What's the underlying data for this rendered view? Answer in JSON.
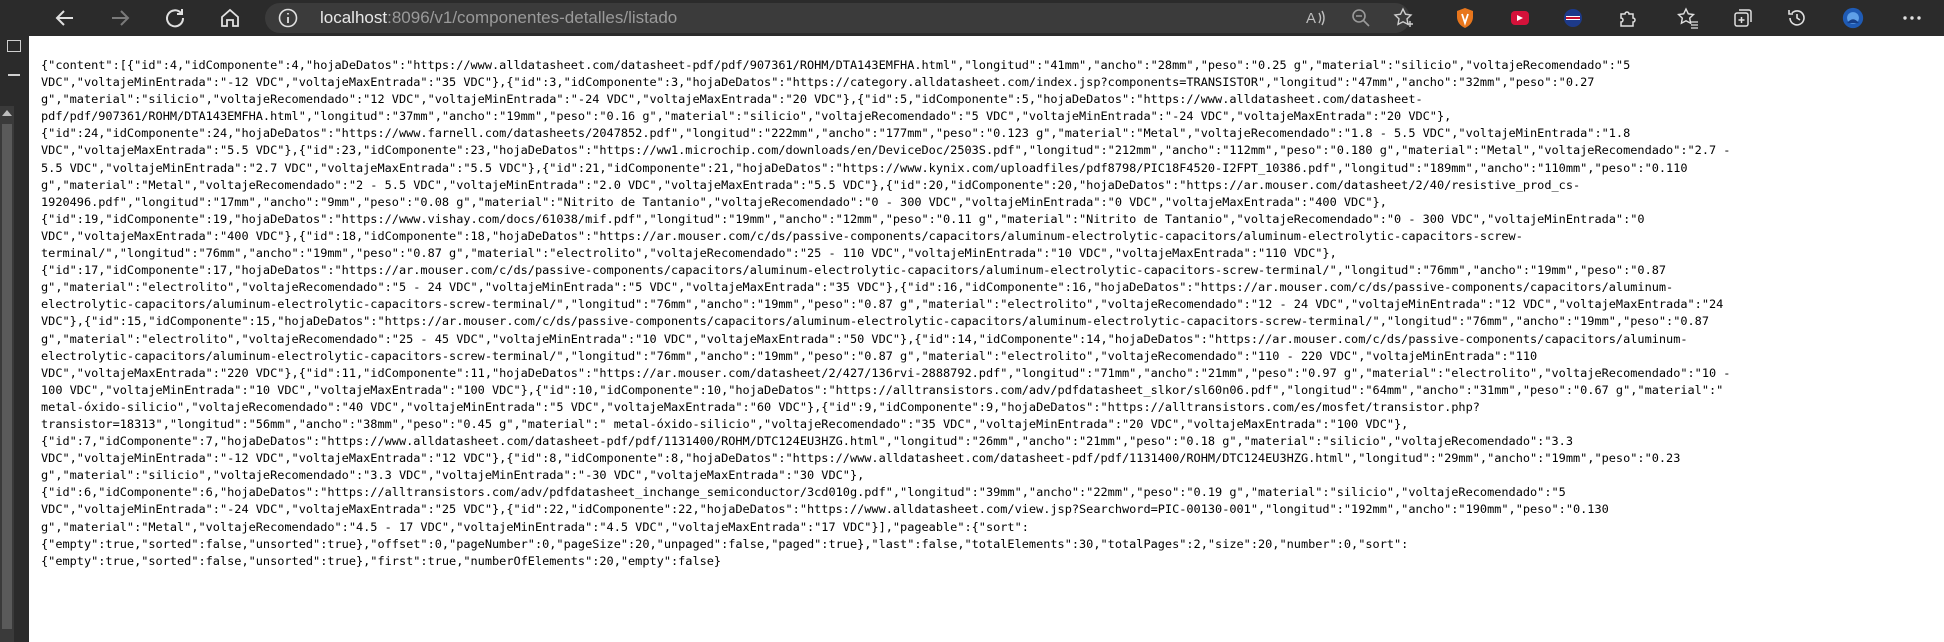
{
  "browser": {
    "url_host": "localhost",
    "url_rest": ":8096/v1/componentes-detalles/listado"
  },
  "json_lines": [
    "{\"content\":[{\"id\":4,\"idComponente\":4,\"hojaDeDatos\":\"https://www.alldatasheet.com/datasheet-pdf/pdf/907361/ROHM/DTA143EMFHA.html\",\"longitud\":\"41mm\",\"ancho\":\"28mm\",\"peso\":\"0.25 g\",\"material\":\"silicio\",\"voltajeRecomendado\":\"5",
    "VDC\",\"voltajeMinEntrada\":\"-12 VDC\",\"voltajeMaxEntrada\":\"35 VDC\"},{\"id\":3,\"idComponente\":3,\"hojaDeDatos\":\"https://category.alldatasheet.com/index.jsp?components=TRANSISTOR\",\"longitud\":\"47mm\",\"ancho\":\"32mm\",\"peso\":\"0.27",
    "g\",\"material\":\"silicio\",\"voltajeRecomendado\":\"12 VDC\",\"voltajeMinEntrada\":\"-24 VDC\",\"voltajeMaxEntrada\":\"20 VDC\"},{\"id\":5,\"idComponente\":5,\"hojaDeDatos\":\"https://www.alldatasheet.com/datasheet-",
    "pdf/pdf/907361/ROHM/DTA143EMFHA.html\",\"longitud\":\"37mm\",\"ancho\":\"19mm\",\"peso\":\"0.16 g\",\"material\":\"silicio\",\"voltajeRecomendado\":\"5 VDC\",\"voltajeMinEntrada\":\"-24 VDC\",\"voltajeMaxEntrada\":\"20 VDC\"},",
    "{\"id\":24,\"idComponente\":24,\"hojaDeDatos\":\"https://www.farnell.com/datasheets/2047852.pdf\",\"longitud\":\"222mm\",\"ancho\":\"177mm\",\"peso\":\"0.123 g\",\"material\":\"Metal\",\"voltajeRecomendado\":\"1.8 - 5.5 VDC\",\"voltajeMinEntrada\":\"1.8",
    "VDC\",\"voltajeMaxEntrada\":\"5.5 VDC\"},{\"id\":23,\"idComponente\":23,\"hojaDeDatos\":\"https://ww1.microchip.com/downloads/en/DeviceDoc/2503S.pdf\",\"longitud\":\"212mm\",\"ancho\":\"112mm\",\"peso\":\"0.180 g\",\"material\":\"Metal\",\"voltajeRecomendado\":\"2.7 -",
    "5.5 VDC\",\"voltajeMinEntrada\":\"2.7 VDC\",\"voltajeMaxEntrada\":\"5.5 VDC\"},{\"id\":21,\"idComponente\":21,\"hojaDeDatos\":\"https://www.kynix.com/uploadfiles/pdf8798/PIC18F4520-I2FPT_10386.pdf\",\"longitud\":\"189mm\",\"ancho\":\"110mm\",\"peso\":\"0.110",
    "g\",\"material\":\"Metal\",\"voltajeRecomendado\":\"2 - 5.5 VDC\",\"voltajeMinEntrada\":\"2.0 VDC\",\"voltajeMaxEntrada\":\"5.5 VDC\"},{\"id\":20,\"idComponente\":20,\"hojaDeDatos\":\"https://ar.mouser.com/datasheet/2/40/resistive_prod_cs-",
    "1920496.pdf\",\"longitud\":\"17mm\",\"ancho\":\"9mm\",\"peso\":\"0.08 g\",\"material\":\"Nitrito de Tantanio\",\"voltajeRecomendado\":\"0 - 300 VDC\",\"voltajeMinEntrada\":\"0 VDC\",\"voltajeMaxEntrada\":\"400 VDC\"},",
    "{\"id\":19,\"idComponente\":19,\"hojaDeDatos\":\"https://www.vishay.com/docs/61038/mif.pdf\",\"longitud\":\"19mm\",\"ancho\":\"12mm\",\"peso\":\"0.11 g\",\"material\":\"Nitrito de Tantanio\",\"voltajeRecomendado\":\"0 - 300 VDC\",\"voltajeMinEntrada\":\"0",
    "VDC\",\"voltajeMaxEntrada\":\"400 VDC\"},{\"id\":18,\"idComponente\":18,\"hojaDeDatos\":\"https://ar.mouser.com/c/ds/passive-components/capacitors/aluminum-electrolytic-capacitors/aluminum-electrolytic-capacitors-screw-",
    "terminal/\",\"longitud\":\"76mm\",\"ancho\":\"19mm\",\"peso\":\"0.87 g\",\"material\":\"electrolito\",\"voltajeRecomendado\":\"25 - 110 VDC\",\"voltajeMinEntrada\":\"10 VDC\",\"voltajeMaxEntrada\":\"110 VDC\"},",
    "{\"id\":17,\"idComponente\":17,\"hojaDeDatos\":\"https://ar.mouser.com/c/ds/passive-components/capacitors/aluminum-electrolytic-capacitors/aluminum-electrolytic-capacitors-screw-terminal/\",\"longitud\":\"76mm\",\"ancho\":\"19mm\",\"peso\":\"0.87",
    "g\",\"material\":\"electrolito\",\"voltajeRecomendado\":\"5 - 24 VDC\",\"voltajeMinEntrada\":\"5 VDC\",\"voltajeMaxEntrada\":\"35 VDC\"},{\"id\":16,\"idComponente\":16,\"hojaDeDatos\":\"https://ar.mouser.com/c/ds/passive-components/capacitors/aluminum-",
    "electrolytic-capacitors/aluminum-electrolytic-capacitors-screw-terminal/\",\"longitud\":\"76mm\",\"ancho\":\"19mm\",\"peso\":\"0.87 g\",\"material\":\"electrolito\",\"voltajeRecomendado\":\"12 - 24 VDC\",\"voltajeMinEntrada\":\"12 VDC\",\"voltajeMaxEntrada\":\"24",
    "VDC\"},{\"id\":15,\"idComponente\":15,\"hojaDeDatos\":\"https://ar.mouser.com/c/ds/passive-components/capacitors/aluminum-electrolytic-capacitors/aluminum-electrolytic-capacitors-screw-terminal/\",\"longitud\":\"76mm\",\"ancho\":\"19mm\",\"peso\":\"0.87",
    "g\",\"material\":\"electrolito\",\"voltajeRecomendado\":\"25 - 45 VDC\",\"voltajeMinEntrada\":\"10 VDC\",\"voltajeMaxEntrada\":\"50 VDC\"},{\"id\":14,\"idComponente\":14,\"hojaDeDatos\":\"https://ar.mouser.com/c/ds/passive-components/capacitors/aluminum-",
    "electrolytic-capacitors/aluminum-electrolytic-capacitors-screw-terminal/\",\"longitud\":\"76mm\",\"ancho\":\"19mm\",\"peso\":\"0.87 g\",\"material\":\"electrolito\",\"voltajeRecomendado\":\"110 - 220 VDC\",\"voltajeMinEntrada\":\"110",
    "VDC\",\"voltajeMaxEntrada\":\"220 VDC\"},{\"id\":11,\"idComponente\":11,\"hojaDeDatos\":\"https://ar.mouser.com/datasheet/2/427/136rvi-2888792.pdf\",\"longitud\":\"71mm\",\"ancho\":\"21mm\",\"peso\":\"0.97 g\",\"material\":\"electrolito\",\"voltajeRecomendado\":\"10 -",
    "100 VDC\",\"voltajeMinEntrada\":\"10 VDC\",\"voltajeMaxEntrada\":\"100 VDC\"},{\"id\":10,\"idComponente\":10,\"hojaDeDatos\":\"https://alltransistors.com/adv/pdfdatasheet_slkor/sl60n06.pdf\",\"longitud\":\"64mm\",\"ancho\":\"31mm\",\"peso\":\"0.67 g\",\"material\":\"",
    "metal-óxido-silicio\",\"voltajeRecomendado\":\"40 VDC\",\"voltajeMinEntrada\":\"5 VDC\",\"voltajeMaxEntrada\":\"60 VDC\"},{\"id\":9,\"idComponente\":9,\"hojaDeDatos\":\"https://alltransistors.com/es/mosfet/transistor.php?",
    "transistor=18313\",\"longitud\":\"56mm\",\"ancho\":\"38mm\",\"peso\":\"0.45 g\",\"material\":\" metal-óxido-silicio\",\"voltajeRecomendado\":\"35 VDC\",\"voltajeMinEntrada\":\"20 VDC\",\"voltajeMaxEntrada\":\"100 VDC\"},",
    "{\"id\":7,\"idComponente\":7,\"hojaDeDatos\":\"https://www.alldatasheet.com/datasheet-pdf/pdf/1131400/ROHM/DTC124EU3HZG.html\",\"longitud\":\"26mm\",\"ancho\":\"21mm\",\"peso\":\"0.18 g\",\"material\":\"silicio\",\"voltajeRecomendado\":\"3.3",
    "VDC\",\"voltajeMinEntrada\":\"-12 VDC\",\"voltajeMaxEntrada\":\"12 VDC\"},{\"id\":8,\"idComponente\":8,\"hojaDeDatos\":\"https://www.alldatasheet.com/datasheet-pdf/pdf/1131400/ROHM/DTC124EU3HZG.html\",\"longitud\":\"29mm\",\"ancho\":\"19mm\",\"peso\":\"0.23",
    "g\",\"material\":\"silicio\",\"voltajeRecomendado\":\"3.3 VDC\",\"voltajeMinEntrada\":\"-30 VDC\",\"voltajeMaxEntrada\":\"30 VDC\"},",
    "{\"id\":6,\"idComponente\":6,\"hojaDeDatos\":\"https://alltransistors.com/adv/pdfdatasheet_inchange_semiconductor/3cd010g.pdf\",\"longitud\":\"39mm\",\"ancho\":\"22mm\",\"peso\":\"0.19 g\",\"material\":\"silicio\",\"voltajeRecomendado\":\"5",
    "VDC\",\"voltajeMinEntrada\":\"-24 VDC\",\"voltajeMaxEntrada\":\"25 VDC\"},{\"id\":22,\"idComponente\":22,\"hojaDeDatos\":\"https://www.alldatasheet.com/view.jsp?Searchword=PIC-00130-001\",\"longitud\":\"192mm\",\"ancho\":\"190mm\",\"peso\":\"0.130",
    "g\",\"material\":\"Metal\",\"voltajeRecomendado\":\"4.5 - 17 VDC\",\"voltajeMinEntrada\":\"4.5 VDC\",\"voltajeMaxEntrada\":\"17 VDC\"}],\"pageable\":{\"sort\":",
    "{\"empty\":true,\"sorted\":false,\"unsorted\":true},\"offset\":0,\"pageNumber\":0,\"pageSize\":20,\"unpaged\":false,\"paged\":true},\"last\":false,\"totalElements\":30,\"totalPages\":2,\"size\":20,\"number\":0,\"sort\":",
    "{\"empty\":true,\"sorted\":false,\"unsorted\":true},\"first\":true,\"numberOfElements\":20,\"empty\":false}"
  ],
  "icons": {
    "back": "arrow-left-icon",
    "forward": "arrow-right-icon",
    "refresh": "refresh-icon",
    "home": "home-icon",
    "site_info": "info-icon",
    "read_aloud": "read-aloud-icon",
    "zoom": "zoom-icon",
    "favorite": "add-favorite-icon",
    "extension_1": "shield-extension-icon",
    "extension_2": "video-extension-icon",
    "extension_3": "flag-extension-icon",
    "extensions": "puzzle-icon",
    "favorites": "favorites-icon",
    "collections": "collections-icon",
    "history": "history-icon",
    "profile": "profile-avatar-icon",
    "menu": "more-menu-icon"
  }
}
